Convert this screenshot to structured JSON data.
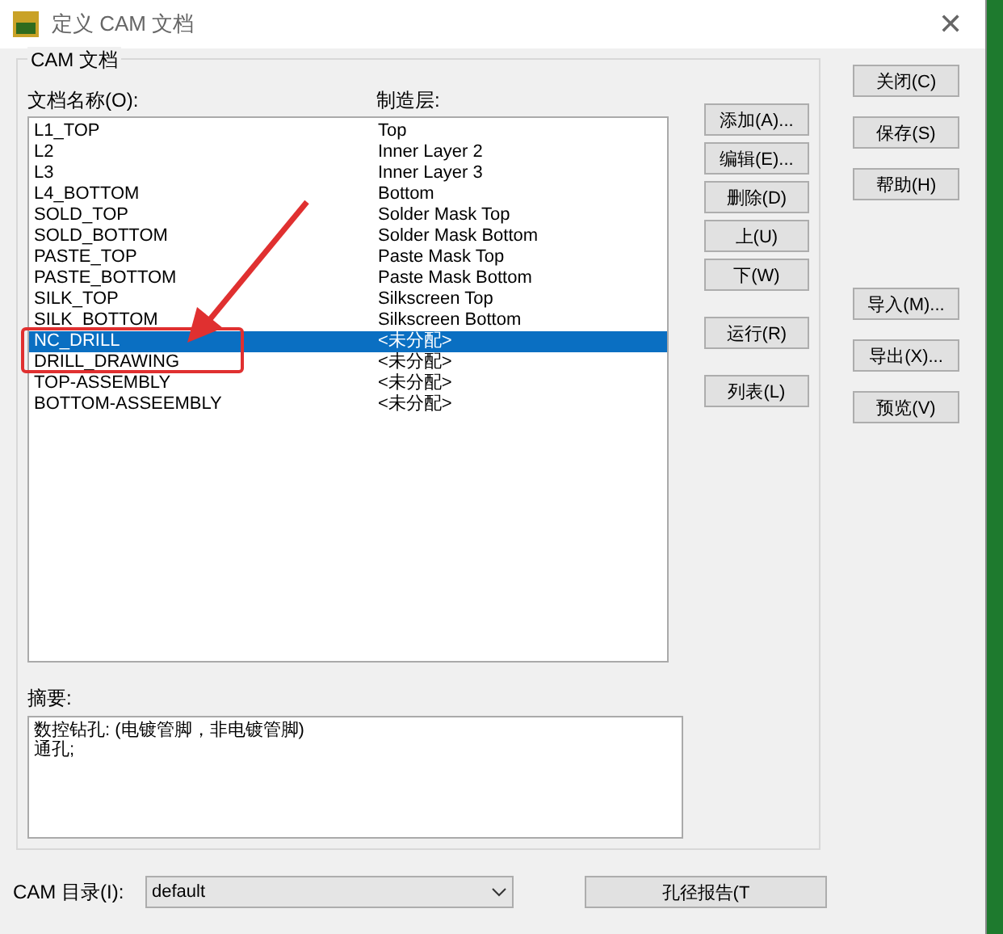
{
  "window": {
    "title": "定义 CAM 文档"
  },
  "group": {
    "title": "CAM 文档"
  },
  "columns": [
    "文档名称(O):",
    "制造层:"
  ],
  "rows": [
    {
      "name": "L1_TOP",
      "layer": "Top",
      "selected": false
    },
    {
      "name": "L2",
      "layer": "Inner Layer 2",
      "selected": false
    },
    {
      "name": "L3",
      "layer": "Inner Layer 3",
      "selected": false
    },
    {
      "name": "L4_BOTTOM",
      "layer": "Bottom",
      "selected": false
    },
    {
      "name": "SOLD_TOP",
      "layer": "Solder Mask Top",
      "selected": false
    },
    {
      "name": "SOLD_BOTTOM",
      "layer": "Solder Mask Bottom",
      "selected": false
    },
    {
      "name": "PASTE_TOP",
      "layer": "Paste Mask Top",
      "selected": false
    },
    {
      "name": "PASTE_BOTTOM",
      "layer": "Paste Mask Bottom",
      "selected": false
    },
    {
      "name": "SILK_TOP",
      "layer": "Silkscreen Top",
      "selected": false
    },
    {
      "name": "SILK_BOTTOM",
      "layer": "Silkscreen Bottom",
      "selected": false
    },
    {
      "name": "NC_DRILL",
      "layer": "<未分配>",
      "selected": true
    },
    {
      "name": "DRILL_DRAWING",
      "layer": "<未分配>",
      "selected": false
    },
    {
      "name": "TOP-ASSEMBLY",
      "layer": "<未分配>",
      "selected": false
    },
    {
      "name": "BOTTOM-ASSEEMBLY",
      "layer": "<未分配>",
      "selected": false
    }
  ],
  "list_buttons": [
    [
      "添加(A)...",
      "编辑(E)...",
      "删除(D)",
      "上(U)",
      "下(W)"
    ],
    [
      "运行(R)"
    ],
    [
      "列表(L)"
    ]
  ],
  "side_buttons": [
    [
      "关闭(C)"
    ],
    [
      "保存(S)"
    ],
    [
      "帮助(H)"
    ],
    [
      "导入(M)..."
    ],
    [
      "导出(X)..."
    ],
    [
      "预览(V)"
    ]
  ],
  "close_button": {
    "label": "✕"
  },
  "summary": {
    "label": "摘要:",
    "lines": [
      "数控钻孔: (电镀管脚，非电镀管脚)",
      "通孔;"
    ]
  },
  "cam_dir": {
    "label": "CAM 目录(I):",
    "value": "default"
  },
  "report_button": {
    "label": "孔径报告(T"
  }
}
